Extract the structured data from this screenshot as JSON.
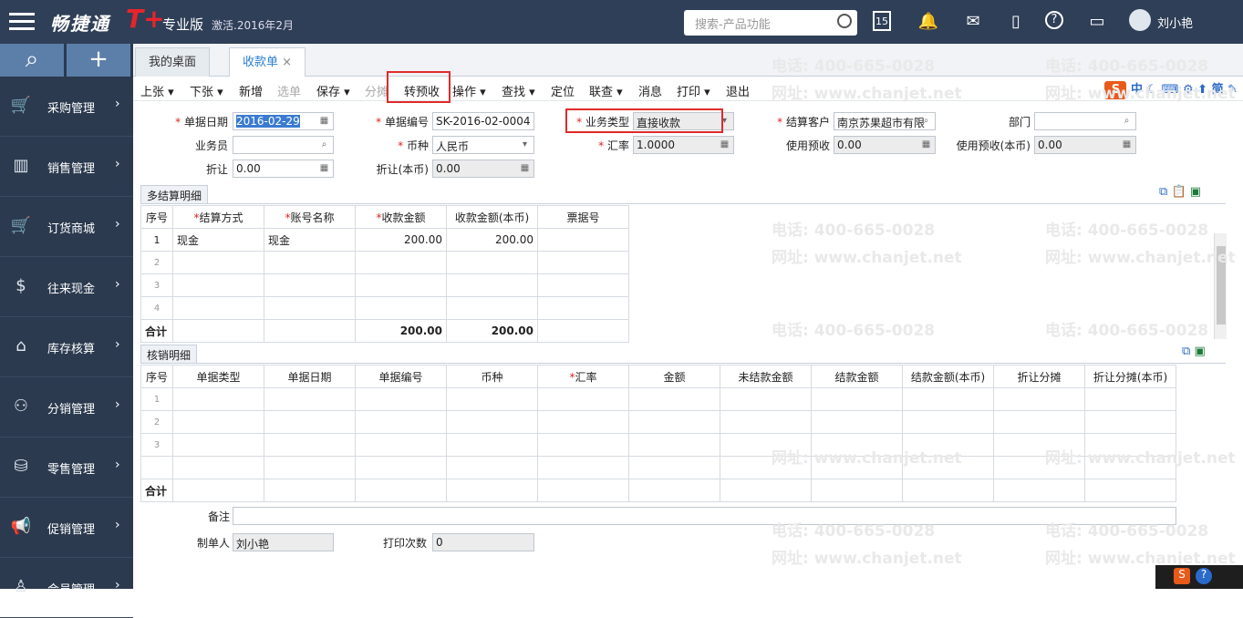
{
  "app": {
    "name": "畅捷通",
    "t": "T+",
    "edition": "专业版",
    "activation": "激活.2016年2月"
  },
  "search": {
    "placeholder": "搜索-产品功能"
  },
  "user": {
    "name": "刘小艳"
  },
  "calendar_day": "15",
  "sidebar": {
    "items": [
      {
        "label": "采购管理",
        "icon": "shopping-cart-icon"
      },
      {
        "label": "销售管理",
        "icon": "bar-chart-icon"
      },
      {
        "label": "订货商城",
        "icon": "cart-icon"
      },
      {
        "label": "往来现金",
        "icon": "dollar-icon"
      },
      {
        "label": "库存核算",
        "icon": "warehouse-icon"
      },
      {
        "label": "分销管理",
        "icon": "distribution-icon"
      },
      {
        "label": "零售管理",
        "icon": "retail-icon"
      },
      {
        "label": "促销管理",
        "icon": "megaphone-icon"
      },
      {
        "label": "会员管理",
        "icon": "member-icon"
      }
    ]
  },
  "tabs": [
    {
      "label": "我的桌面"
    },
    {
      "label": "收款单",
      "closable": true
    }
  ],
  "toolbar": {
    "prev": "上张",
    "next": "下张",
    "add": "新增",
    "select": "选单",
    "save": "保存",
    "split": "分摊",
    "to_prepay": "转预收",
    "operate": "操作",
    "find": "查找",
    "locate": "定位",
    "linked": "联查",
    "message": "消息",
    "print": "打印",
    "exit": "退出"
  },
  "ime": {
    "lang": "中",
    "mode": "简"
  },
  "form": {
    "doc_date_label": "单据日期",
    "doc_date": "2016-02-29",
    "doc_no_label": "单据编号",
    "doc_no": "SK-2016-02-0004",
    "biz_type_label": "业务类型",
    "biz_type": "直接收款",
    "customer_label": "结算客户",
    "customer": "南京苏果超市有限",
    "dept_label": "部门",
    "dept": "",
    "staff_label": "业务员",
    "staff": "",
    "currency_label": "币种",
    "currency": "人民币",
    "rate_label": "汇率",
    "rate": "1.0000",
    "use_prepay_label": "使用预收",
    "use_prepay": "0.00",
    "use_prepay_local_label": "使用预收(本币)",
    "use_prepay_local": "0.00",
    "discount_label": "折让",
    "discount": "0.00",
    "discount_local_label": "折让(本币)",
    "discount_local": "0.00"
  },
  "settle": {
    "tab": "多结算明细",
    "headers": [
      "序号",
      "结算方式",
      "账号名称",
      "收款金额",
      "收款金额(本币)",
      "票据号"
    ],
    "rows": [
      [
        "1",
        "现金",
        "现金",
        "200.00",
        "200.00",
        ""
      ],
      [
        "2",
        "",
        "",
        "",
        "",
        ""
      ],
      [
        "3",
        "",
        "",
        "",
        "",
        ""
      ],
      [
        "4",
        "",
        "",
        "",
        "",
        ""
      ]
    ],
    "total_label": "合计",
    "total_amount": "200.00",
    "total_local": "200.00"
  },
  "verify": {
    "tab": "核销明细",
    "headers": [
      "序号",
      "单据类型",
      "单据日期",
      "单据编号",
      "币种",
      "汇率",
      "金额",
      "未结款金额",
      "结款金额",
      "结款金额(本币)",
      "折让分摊",
      "折让分摊(本币)"
    ],
    "rows": [
      [
        "1"
      ],
      [
        "2"
      ],
      [
        "3"
      ]
    ],
    "total_label": "合计"
  },
  "footer": {
    "remark_label": "备注",
    "remark": "",
    "maker_label": "制单人",
    "maker": "刘小艳",
    "print_count_label": "打印次数",
    "print_count": "0"
  },
  "watermark": {
    "phone": "电话: 400-665-0028",
    "site": "网址: www.chanjet.net"
  },
  "colors": {
    "topbar": "#2f3f57",
    "sidebar": "#2b3a4f",
    "accent": "#2a7fd3",
    "highlight": "#e02a2a"
  }
}
